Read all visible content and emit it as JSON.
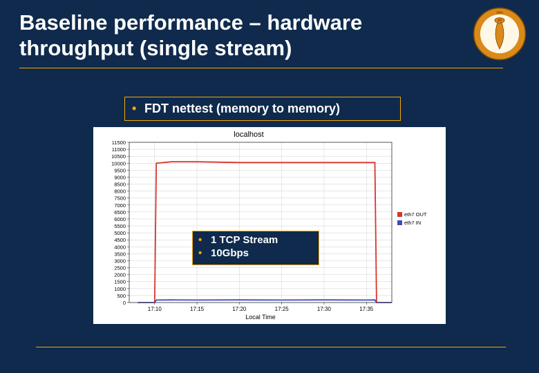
{
  "title": "Baseline performance – hardware throughput (single stream)",
  "bullet_main": "FDT nettest (memory to memory)",
  "annotation": {
    "line1": "1 TCP Stream",
    "line2": "10Gbps"
  },
  "logo_name": "caltech-seal",
  "colors": {
    "bg": "#0f2a4c",
    "accent": "#f7a800",
    "series_out": "#d8352c",
    "series_in": "#3a4cc0"
  },
  "chart_data": {
    "type": "line",
    "title": "localhost",
    "xlabel": "Local Time",
    "ylabel": "",
    "ylim": [
      0,
      11500
    ],
    "y_ticks": [
      0,
      500,
      1000,
      1500,
      2000,
      2500,
      3000,
      3500,
      4000,
      4500,
      5000,
      5500,
      6000,
      6500,
      7000,
      7500,
      8000,
      8500,
      9000,
      9500,
      10000,
      10500,
      11000,
      11500
    ],
    "x_ticks": [
      "17:10",
      "17:15",
      "17:20",
      "17:25",
      "17:30",
      "17:35"
    ],
    "series": [
      {
        "name": "eth7 OUT",
        "color": "#d8352c",
        "x": [
          "17:08",
          "17:10",
          "17:10.2",
          "17:12",
          "17:15",
          "17:20",
          "17:25",
          "17:30",
          "17:35",
          "17:36",
          "17:36.2",
          "17:38"
        ],
        "values": [
          0,
          0,
          10000,
          10100,
          10100,
          10050,
          10050,
          10050,
          10050,
          10050,
          0,
          0
        ]
      },
      {
        "name": "eth7 IN",
        "color": "#3a4cc0",
        "x": [
          "17:08",
          "17:10",
          "17:10.2",
          "17:12",
          "17:15",
          "17:20",
          "17:25",
          "17:30",
          "17:35",
          "17:36",
          "17:36.2",
          "17:38"
        ],
        "values": [
          0,
          0,
          180,
          190,
          180,
          190,
          180,
          190,
          180,
          190,
          0,
          0
        ]
      }
    ]
  }
}
